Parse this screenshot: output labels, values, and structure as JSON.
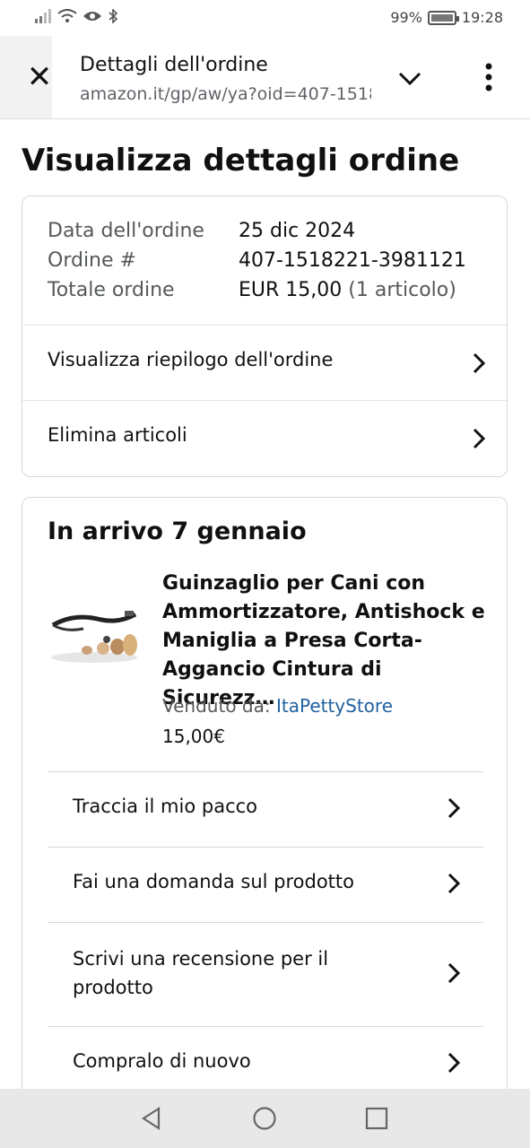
{
  "status_bar": {
    "battery": "99%",
    "time": "19:28"
  },
  "browser": {
    "page_title": "Dettagli dell'ordine",
    "url": "amazon.it/gp/aw/ya?oid=407-1518"
  },
  "page": {
    "heading": "Visualizza dettagli ordine"
  },
  "order_summary": {
    "rows": [
      {
        "label": "Data dell'ordine",
        "value": "25 dic 2024",
        "extra": ""
      },
      {
        "label": "Ordine #",
        "value": "407-1518221-3981121",
        "extra": ""
      },
      {
        "label": "Totale ordine",
        "value": "EUR 15,00",
        "extra": "(1 articolo)"
      }
    ],
    "links": [
      {
        "label": "Visualizza riepilogo dell'ordine"
      },
      {
        "label": "Elimina articoli"
      }
    ]
  },
  "shipment": {
    "arrival": "In arrivo 7 gennaio",
    "product": {
      "title": "Guinzaglio per Cani con Ammortizzatore, Antishock e Maniglia a Presa Corta-Aggancio Cintura di Sicurezz…",
      "seller_label": "Venduto da:",
      "seller_name": "ItaPettyStore",
      "price": "15,00€"
    },
    "actions": [
      {
        "label": "Traccia il mio pacco"
      },
      {
        "label": "Fai una domanda sul prodotto"
      },
      {
        "label": "Scrivi una recensione per il prodotto"
      },
      {
        "label": "Compralo di nuovo"
      }
    ]
  },
  "icons": {
    "close": "close-icon",
    "expand": "chevron-down-icon",
    "menu": "more-vert-icon",
    "row_arrow": "chevron-right-icon",
    "nav_back": "back-triangle-icon",
    "nav_home": "home-circle-icon",
    "nav_recent": "recents-square-icon"
  },
  "colors": {
    "link": "#2162a1",
    "muted": "#565959",
    "border": "#d5d9d9"
  }
}
